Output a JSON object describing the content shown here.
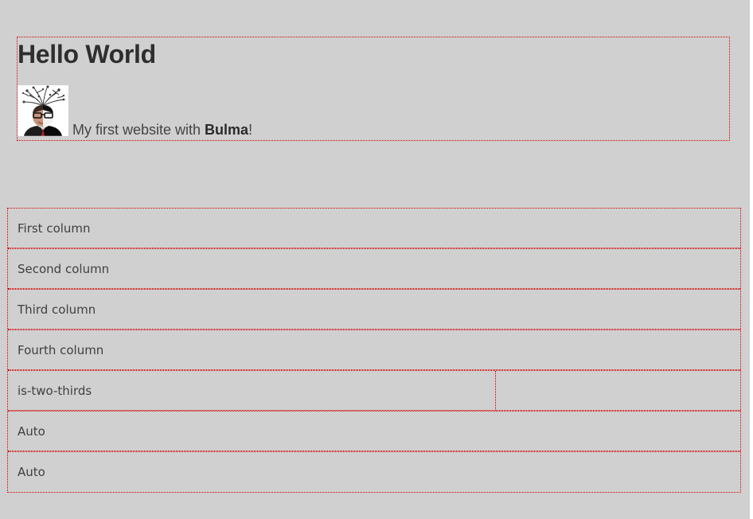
{
  "hero": {
    "title": "Hello World",
    "subtitle_prefix": "My first website with ",
    "subtitle_brand": "Bulma",
    "subtitle_suffix": "!"
  },
  "columns": {
    "rows": [
      [
        "First column"
      ],
      [
        "Second column"
      ],
      [
        "Third column"
      ],
      [
        "Fourth column"
      ],
      [
        "is-two-thirds",
        ""
      ],
      [
        "Auto"
      ],
      [
        "Auto"
      ]
    ]
  },
  "colors": {
    "background": "#d0d0d0",
    "outline": "#d40000",
    "text": "#363636"
  }
}
